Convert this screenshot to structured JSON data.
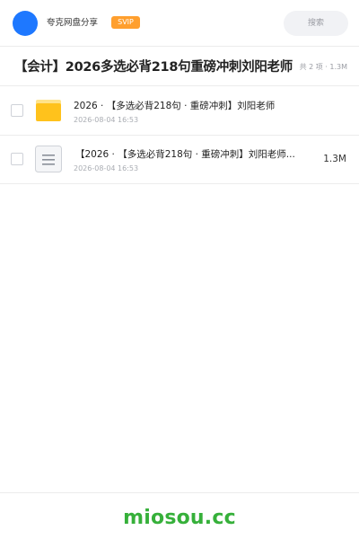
{
  "header": {
    "share_name": "夸克网盘分享",
    "badge": "SVIP",
    "search_placeholder": "搜索",
    "accent_color": "#1e78ff",
    "badge_color": "#ff9f2e"
  },
  "folder": {
    "title": "【会计】2026多选必背218句重磅冲刺刘阳老师",
    "meta": "共 2 项 · 1.3M"
  },
  "files": [
    {
      "name": "2026 · 【多选必背218句 · 重磅冲刺】刘阳老师",
      "date": "2026-08-04 16:53",
      "size": "",
      "icon": "folder-icon"
    },
    {
      "name": "【2026 · 【多选必背218句 · 重磅冲刺】刘阳老师...",
      "date": "2026-08-04 16:53",
      "size": "1.3M",
      "icon": "document-icon"
    }
  ],
  "footer": {
    "brand": "miosou.cc",
    "brand_color": "#36b03a"
  }
}
